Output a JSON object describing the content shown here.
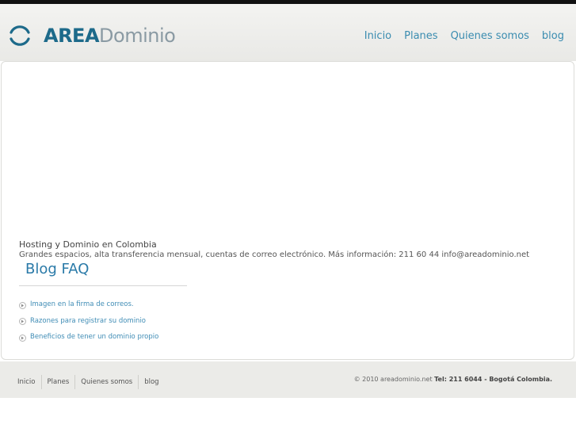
{
  "brand": {
    "name_bold": "AREA",
    "name_light": "Dominio",
    "logo_color": "#1d6a8a"
  },
  "nav": {
    "items": [
      {
        "label": "Inicio"
      },
      {
        "label": "Planes"
      },
      {
        "label": "Quienes somos"
      },
      {
        "label": "blog"
      }
    ]
  },
  "content": {
    "tagline_title": "Hosting y Dominio en Colombia",
    "tagline_desc": "Grandes espacios, alta transferencia mensual, cuentas de correo electrónico. Más información: 211 60 44 info@areadominio.net"
  },
  "blog": {
    "title": "Blog FAQ",
    "items": [
      {
        "label": "Imagen en la firma de correos."
      },
      {
        "label": "Razones para registrar su dominio"
      },
      {
        "label": "Beneficios de tener un dominio propio"
      }
    ]
  },
  "footer": {
    "nav": [
      {
        "label": "Inicio"
      },
      {
        "label": "Planes"
      },
      {
        "label": "Quienes somos"
      },
      {
        "label": "blog"
      }
    ],
    "copyright": "© 2010 areadominio.net",
    "contact": "Tel: 211 6044 - Bogotá Colombia."
  },
  "icons": {
    "logo": "refresh-arc-icon",
    "bullet": "arrow-right-circle-icon"
  }
}
